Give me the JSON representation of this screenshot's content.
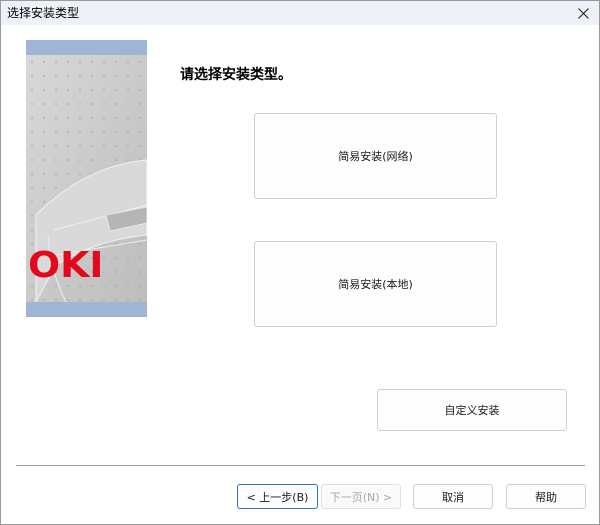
{
  "window": {
    "title": "选择安装类型"
  },
  "banner": {
    "logo_text": "OKI"
  },
  "main": {
    "heading": "请选择安装类型。",
    "network_install_label": "简易安装(网络)",
    "local_install_label": "简易安装(本地)",
    "custom_install_label": "自定义安装"
  },
  "footer": {
    "back_label": "< 上一步(B)",
    "next_label": "下一页(N) >",
    "cancel_label": "取消",
    "help_label": "帮助"
  },
  "colors": {
    "brand_red": "#e3081b",
    "banner_blue": "#9eb6d6",
    "focus_blue": "#2f6fc6"
  },
  "icons": {
    "close": "close-icon"
  }
}
